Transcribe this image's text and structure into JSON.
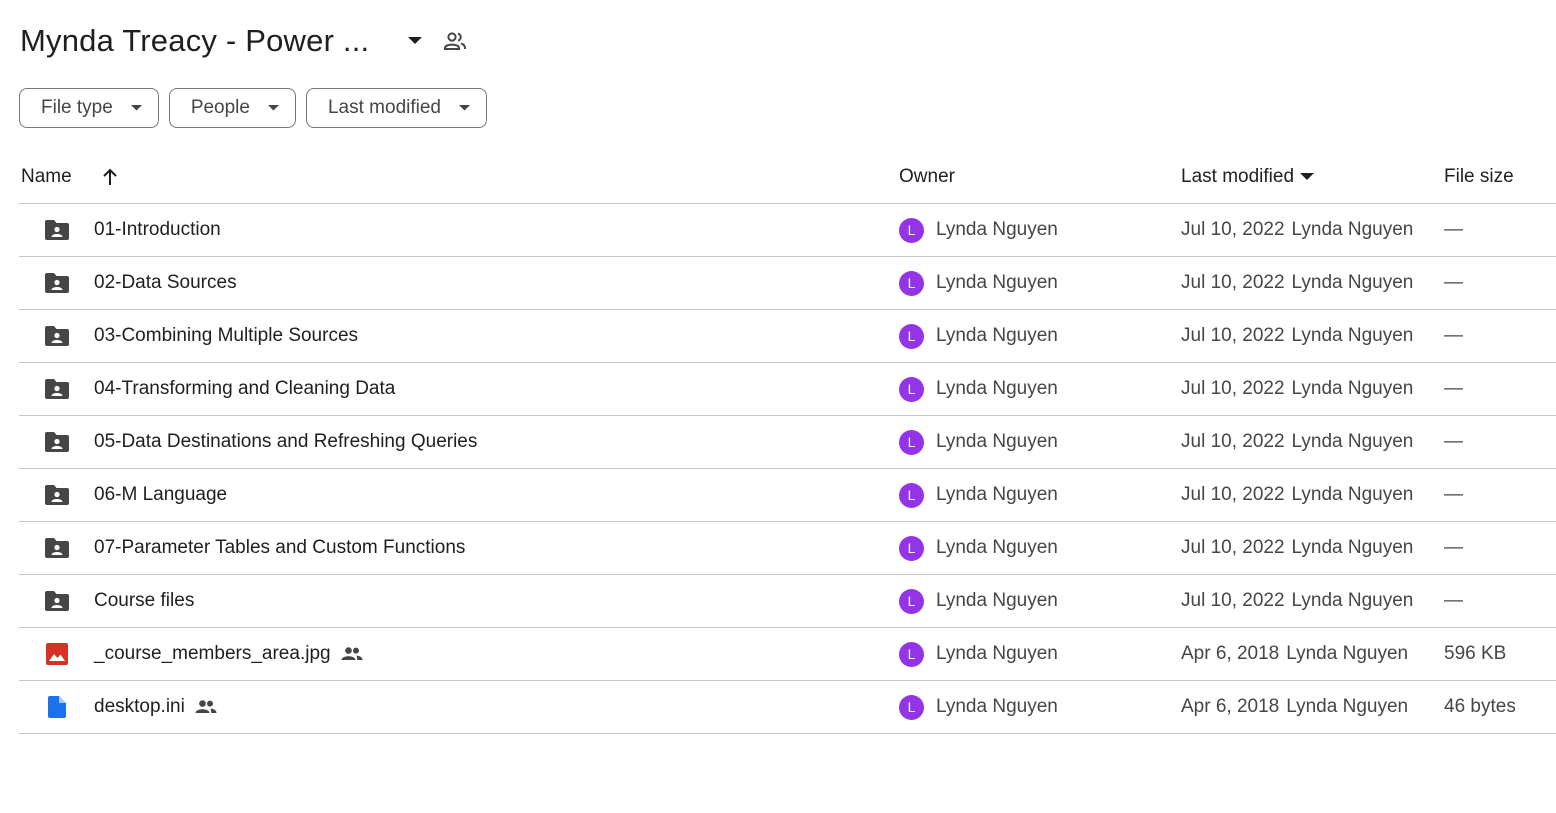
{
  "header": {
    "title": "Mynda Treacy - Power ..."
  },
  "filters": [
    {
      "label": "File type"
    },
    {
      "label": "People"
    },
    {
      "label": "Last modified"
    }
  ],
  "columns": {
    "name": "Name",
    "owner": "Owner",
    "last_modified": "Last modified",
    "file_size": "File size"
  },
  "colors": {
    "avatar": "#9334e6",
    "folder_icon": "#444746",
    "image_icon": "#d93025",
    "doc_icon": "#1a73e8"
  },
  "rows": [
    {
      "name": "01-Introduction",
      "icon": "shared-folder-icon",
      "shared": false,
      "owner": "Lynda Nguyen",
      "owner_initial": "L",
      "modified_date": "Jul 10, 2022",
      "modified_by": "Lynda Nguyen",
      "size": "—"
    },
    {
      "name": "02-Data Sources",
      "icon": "shared-folder-icon",
      "shared": false,
      "owner": "Lynda Nguyen",
      "owner_initial": "L",
      "modified_date": "Jul 10, 2022",
      "modified_by": "Lynda Nguyen",
      "size": "—"
    },
    {
      "name": "03-Combining Multiple Sources",
      "icon": "shared-folder-icon",
      "shared": false,
      "owner": "Lynda Nguyen",
      "owner_initial": "L",
      "modified_date": "Jul 10, 2022",
      "modified_by": "Lynda Nguyen",
      "size": "—"
    },
    {
      "name": "04-Transforming and Cleaning Data",
      "icon": "shared-folder-icon",
      "shared": false,
      "owner": "Lynda Nguyen",
      "owner_initial": "L",
      "modified_date": "Jul 10, 2022",
      "modified_by": "Lynda Nguyen",
      "size": "—"
    },
    {
      "name": "05-Data Destinations and Refreshing Queries",
      "icon": "shared-folder-icon",
      "shared": false,
      "owner": "Lynda Nguyen",
      "owner_initial": "L",
      "modified_date": "Jul 10, 2022",
      "modified_by": "Lynda Nguyen",
      "size": "—"
    },
    {
      "name": "06-M Language",
      "icon": "shared-folder-icon",
      "shared": false,
      "owner": "Lynda Nguyen",
      "owner_initial": "L",
      "modified_date": "Jul 10, 2022",
      "modified_by": "Lynda Nguyen",
      "size": "—"
    },
    {
      "name": "07-Parameter Tables and Custom Functions",
      "icon": "shared-folder-icon",
      "shared": false,
      "owner": "Lynda Nguyen",
      "owner_initial": "L",
      "modified_date": "Jul 10, 2022",
      "modified_by": "Lynda Nguyen",
      "size": "—"
    },
    {
      "name": "Course files",
      "icon": "shared-folder-icon",
      "shared": false,
      "owner": "Lynda Nguyen",
      "owner_initial": "L",
      "modified_date": "Jul 10, 2022",
      "modified_by": "Lynda Nguyen",
      "size": "—"
    },
    {
      "name": "_course_members_area.jpg",
      "icon": "image-file-icon",
      "shared": true,
      "owner": "Lynda Nguyen",
      "owner_initial": "L",
      "modified_date": "Apr 6, 2018",
      "modified_by": "Lynda Nguyen",
      "size": "596 KB"
    },
    {
      "name": "desktop.ini",
      "icon": "document-file-icon",
      "shared": true,
      "owner": "Lynda Nguyen",
      "owner_initial": "L",
      "modified_date": "Apr 6, 2018",
      "modified_by": "Lynda Nguyen",
      "size": "46 bytes"
    }
  ]
}
